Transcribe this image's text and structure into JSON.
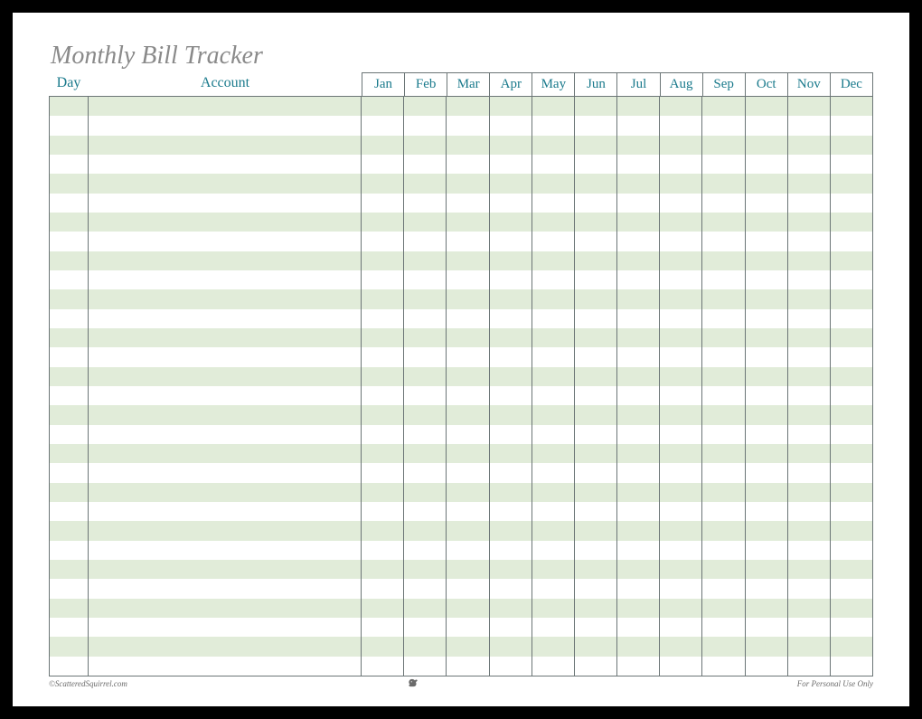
{
  "title": "Monthly Bill Tracker",
  "headers": {
    "day": "Day",
    "account": "Account",
    "months": [
      "Jan",
      "Feb",
      "Mar",
      "Apr",
      "May",
      "Jun",
      "Jul",
      "Aug",
      "Sep",
      "Oct",
      "Nov",
      "Dec"
    ]
  },
  "footer": {
    "left": "©ScatteredSquirrel.com",
    "right": "For Personal Use Only"
  },
  "row_count": 30
}
